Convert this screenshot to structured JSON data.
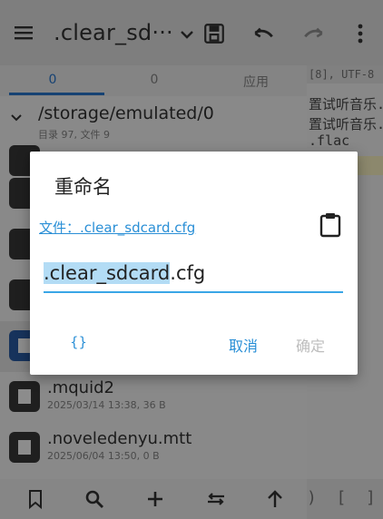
{
  "toolbar": {
    "title": ".clear_sd···",
    "icons": [
      "menu-icon",
      "chevron-down-icon",
      "save-icon",
      "undo-icon",
      "redo-icon",
      "more-vert-icon"
    ]
  },
  "tabs": [
    {
      "label": "0"
    },
    {
      "label": "0"
    },
    {
      "label": "应用"
    }
  ],
  "path": {
    "dir": "/storage/emulated/0",
    "summary": "目录 97, 文件 9"
  },
  "files": [
    {
      "name": ".mquid2",
      "meta": "2025/03/14 13:38, 36 B"
    },
    {
      "name": ".noveledenyu.mtt",
      "meta": "2025/06/04 13:50, 0 B"
    }
  ],
  "editor": {
    "encoding": "[8], UTF-8",
    "lines": [
      "置试听音乐.",
      "置试听音乐.",
      ".flac"
    ],
    "bottom_text": ")  [  ]"
  },
  "dialog": {
    "title": "重命名",
    "file_link": "文件：.clear_sdcard.cfg",
    "input_selected": ".clear_sdcard",
    "input_rest": ".cfg",
    "braces_label": "{}",
    "cancel_label": "取消",
    "ok_label": "确定"
  },
  "colors": {
    "accent": "#2a8fd6",
    "selection": "#b3dcf5",
    "scrim": "rgba(0,0,0,0.45)"
  }
}
